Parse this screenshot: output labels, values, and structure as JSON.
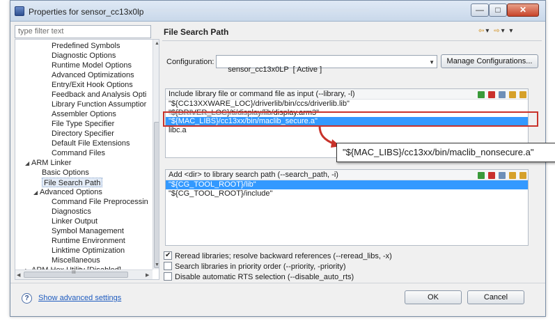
{
  "window": {
    "title": "Properties for sensor_cc13x0lp",
    "minimize_glyph": "—",
    "maximize_glyph": "□",
    "close_glyph": "✕"
  },
  "sidebar": {
    "filter_placeholder": "type filter text",
    "items": [
      {
        "label": "Predefined Symbols"
      },
      {
        "label": "Diagnostic Options"
      },
      {
        "label": "Runtime Model Options"
      },
      {
        "label": "Advanced Optimizations"
      },
      {
        "label": "Entry/Exit Hook Options"
      },
      {
        "label": "Feedback and Analysis Opti"
      },
      {
        "label": "Library Function Assumptior"
      },
      {
        "label": "Assembler Options"
      },
      {
        "label": "File Type Specifier"
      },
      {
        "label": "Directory Specifier"
      },
      {
        "label": "Default File Extensions"
      },
      {
        "label": "Command Files"
      },
      {
        "label": "ARM Linker",
        "expander": "◢"
      },
      {
        "label": "Basic Options"
      },
      {
        "label": "File Search Path",
        "selected": true
      },
      {
        "label": "Advanced Options",
        "expander": "◢"
      },
      {
        "label": "Command File Preprocessin"
      },
      {
        "label": "Diagnostics"
      },
      {
        "label": "Linker Output"
      },
      {
        "label": "Symbol Management"
      },
      {
        "label": "Runtime Environment"
      },
      {
        "label": "Linktime Optimization"
      },
      {
        "label": "Miscellaneous"
      },
      {
        "label": "ARM Hex Utility  [Disabled]",
        "expander": "▷"
      }
    ],
    "scroll_up": "▲",
    "scroll_down": "▼",
    "scroll_left": "◀",
    "scroll_right": "▶",
    "hthumb_grip": "III"
  },
  "page": {
    "title": "File Search Path",
    "nav_icons": [
      "back-arrow-icon",
      "forward-arrow-icon",
      "menu-icon"
    ],
    "nav_glyphs": {
      "back": "⇦",
      "drop1": "▾",
      "forward": "⇨",
      "drop2": "▾",
      "menu": "▾"
    }
  },
  "configuration": {
    "label": "Configuration:",
    "value": "sensor_cc13x0LP  [ Active ]",
    "caret": "▼",
    "manage_button": "Manage Configurations..."
  },
  "library_panel": {
    "header": "Include library file or command file as input (--library, -l)",
    "items": [
      "\"${CC13XXWARE_LOC}/driverlib/bin/ccs/driverlib.lib\"",
      "\"${DRIVER_LOC}/ti/display/lib/display.arm3\"",
      "\"${MAC_LIBS}/cc13xx/bin/maclib_secure.a\"",
      "libc.a"
    ],
    "selected_index": 2,
    "tool_icons": [
      "add-icon",
      "delete-icon",
      "edit-icon",
      "move-up-icon",
      "move-down-icon"
    ]
  },
  "callout": {
    "text": "\"${MAC_LIBS}/cc13xx/bin/maclib_nonsecure.a\""
  },
  "search_panel": {
    "header": "Add <dir> to library search path (--search_path, -i)",
    "items": [
      "\"${CG_TOOL_ROOT}/lib\"",
      "\"${CG_TOOL_ROOT}/include\""
    ],
    "selected_index": 0,
    "tool_icons": [
      "add-icon",
      "delete-icon",
      "edit-icon",
      "move-up-icon",
      "move-down-icon"
    ]
  },
  "options": [
    {
      "label": "Reread libraries; resolve backward references (--reread_libs, -x)",
      "checked": true
    },
    {
      "label": "Search libraries in priority order (--priority, -priority)",
      "checked": false
    },
    {
      "label": "Disable automatic RTS selection (--disable_auto_rts)",
      "checked": false
    }
  ],
  "footer": {
    "help_glyph": "?",
    "advanced_link": "Show advanced settings",
    "ok_label": "OK",
    "cancel_label": "Cancel"
  },
  "colors": {
    "selection": "#3399ff",
    "highlight_border": "#c8322a",
    "link": "#1f5cbf"
  }
}
